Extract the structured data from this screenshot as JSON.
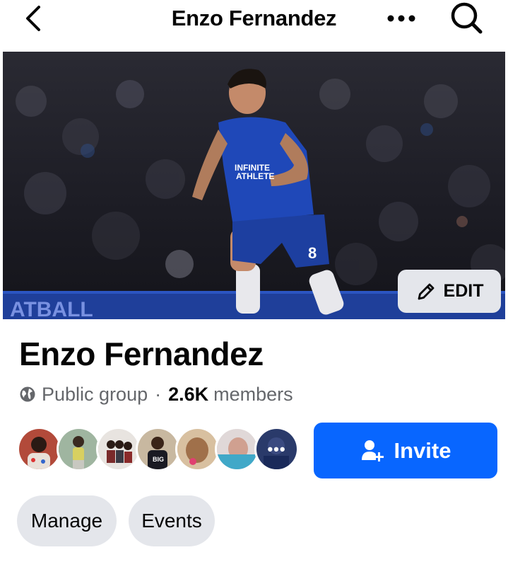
{
  "topbar": {
    "title": "Enzo Fernandez",
    "back_icon": "chevron-left-icon",
    "more_icon": "more-horizontal-icon",
    "search_icon": "search-icon"
  },
  "cover": {
    "edit_label": "EDIT",
    "edit_icon": "pencil-icon"
  },
  "group": {
    "name": "Enzo Fernandez",
    "privacy": "Public group",
    "separator": "·",
    "member_count": "2.6K",
    "members_label": "members"
  },
  "actions": {
    "invite_label": "Invite",
    "invite_icon": "add-person-icon",
    "more_members_glyph": "•••"
  },
  "tabs": [
    {
      "label": "Manage"
    },
    {
      "label": "Events"
    }
  ],
  "colors": {
    "accent": "#0866ff",
    "pill_bg": "#e4e6eb",
    "secondary_text": "#65676b",
    "jersey_blue": "#1d3fa0"
  }
}
